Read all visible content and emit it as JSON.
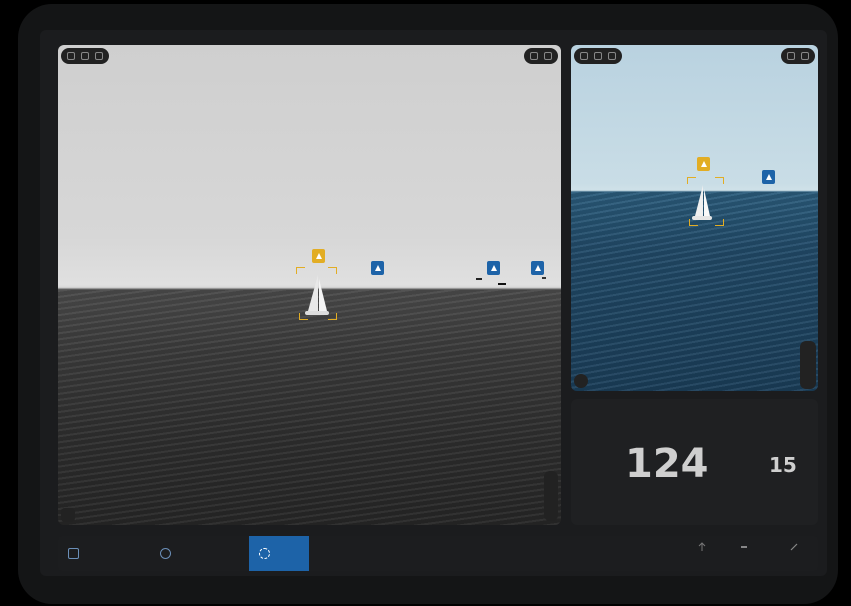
{
  "left_camera": {
    "toolbar_left": [
      "",
      ""
    ],
    "toolbar_right": ""
  },
  "right_camera": {
    "toolbar_left": [
      "",
      ""
    ],
    "toolbar_right": ""
  },
  "panel": {
    "label_left": "",
    "label_right": "",
    "value_primary": "124",
    "value_secondary": "15",
    "foot_left": "",
    "foot_right": ""
  },
  "bottom_bar": {
    "modes": [
      "",
      "",
      ""
    ],
    "active_mode_index": 2,
    "tools": [
      "",
      "",
      ""
    ]
  },
  "colors": {
    "accent_blue": "#1d63a8",
    "target_yellow": "#e2ad24",
    "background": "#1b1c1e"
  },
  "icons": {
    "yellow_marker": "sailboat-target-icon",
    "blue_marker": "vessel-icon",
    "active_mode": "target-ring-icon"
  }
}
